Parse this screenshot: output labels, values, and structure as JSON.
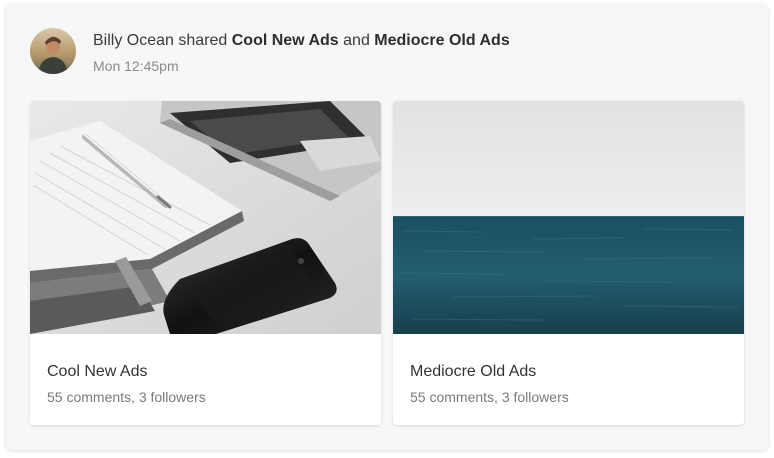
{
  "share": {
    "actor": "Billy Ocean",
    "verb": " shared ",
    "item_one": "Cool New Ads",
    "conjunction": " and ",
    "item_two": "Mediocre Old Ads",
    "timestamp": "Mon 12:45pm"
  },
  "cards": [
    {
      "title": "Cool New Ads",
      "meta": "55 comments, 3 followers",
      "image": "desk-notebook-laptop-phone-photo"
    },
    {
      "title": "Mediocre Old Ads",
      "meta": "55 comments, 3 followers",
      "image": "ocean-horizon-photo"
    }
  ],
  "colors": {
    "panel_background": "#f7f7f7",
    "card_background": "#ffffff",
    "ocean": "#1f5a6c",
    "sky": "#e4e4e4"
  }
}
